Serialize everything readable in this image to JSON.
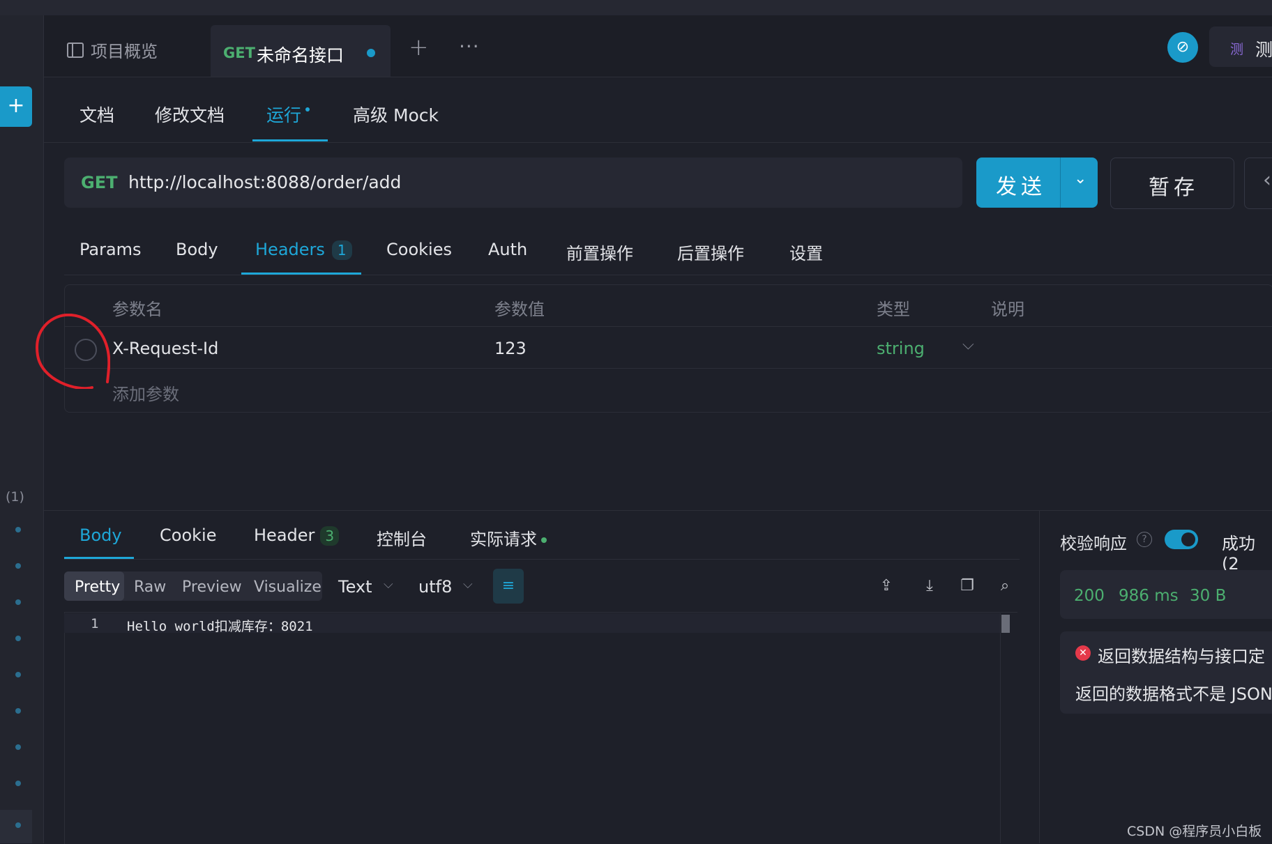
{
  "tabs": {
    "overview_label": "项目概览",
    "active_method": "GET",
    "active_title": "未命名接口",
    "add_symbol": "+",
    "more_symbol": "···",
    "env_icon": "测",
    "env_label": "测"
  },
  "subtabs": {
    "items": [
      "文档",
      "修改文档",
      "运行",
      "高级 Mock"
    ],
    "active": "运行"
  },
  "request": {
    "method": "GET",
    "url": "http://localhost:8088/order/add",
    "send_label": "发送",
    "save_label": "暂存"
  },
  "params_tabs": {
    "items": [
      "Params",
      "Body",
      "Headers",
      "Cookies",
      "Auth",
      "前置操作",
      "后置操作",
      "设置"
    ],
    "headers_count": "1",
    "active": "Headers"
  },
  "headers_table": {
    "columns": [
      "参数名",
      "参数值",
      "类型",
      "说明"
    ],
    "rows": [
      {
        "name": "X-Request-Id",
        "value": "123",
        "type": "string",
        "desc": "",
        "enabled": false
      }
    ],
    "add_placeholder": "添加参数"
  },
  "sidebar": {
    "count_label": "(1)"
  },
  "response": {
    "tabs": [
      "Body",
      "Cookie",
      "Header",
      "控制台",
      "实际请求"
    ],
    "header_count": "3",
    "active": "Body",
    "view_modes": [
      "Pretty",
      "Raw",
      "Preview",
      "Visualize"
    ],
    "active_view": "Pretty",
    "format": "Text",
    "encoding": "utf8",
    "line_number": "1",
    "body_line": "Hello world扣减库存：8021"
  },
  "verification": {
    "label": "校验响应",
    "toggle_on": true,
    "result_label": "成功 (2",
    "status_code": "200",
    "time": "986 ms",
    "size": "30 B",
    "error_title": "返回数据结构与接口定",
    "error_message": "返回的数据格式不是 JSON"
  },
  "watermark": "CSDN @程序员小白板",
  "colors": {
    "accent": "#1a9ac9",
    "method_get": "#4caf70",
    "background": "#1e2029",
    "error": "#e5394a",
    "annotation": "#e0202a"
  }
}
